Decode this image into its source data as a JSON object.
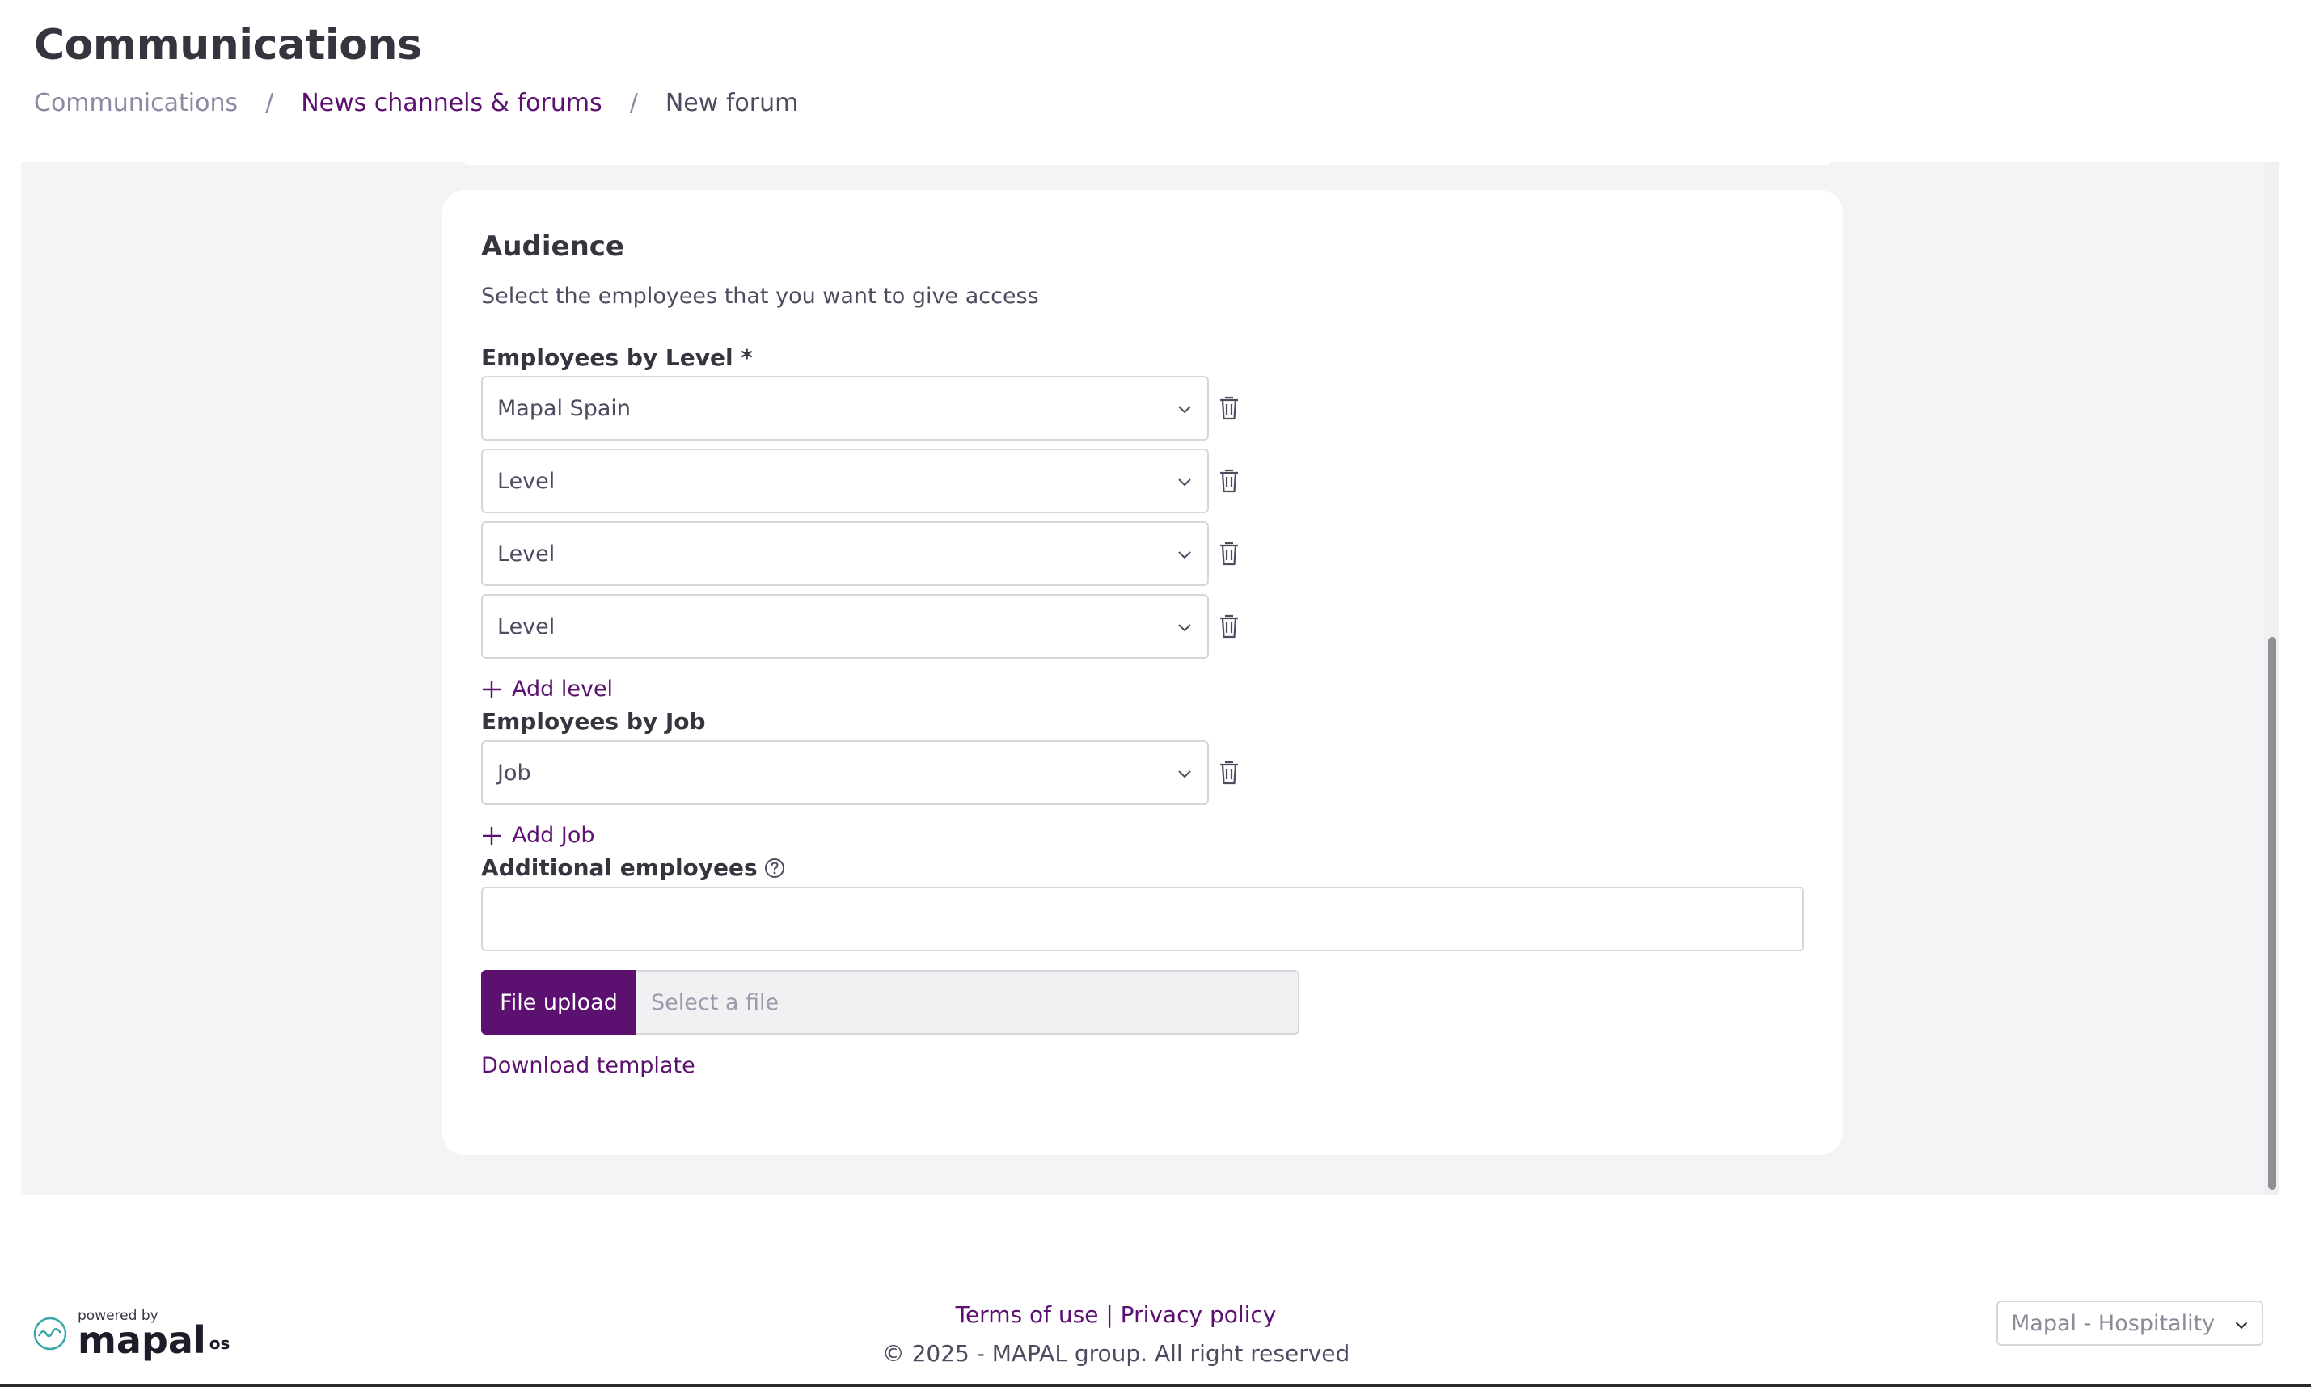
{
  "header": {
    "title": "Communications",
    "breadcrumb": {
      "root": "Communications",
      "parent": "News channels & forums",
      "current": "New forum",
      "separator": "/"
    }
  },
  "audience": {
    "title": "Audience",
    "description": "Select the employees that you want to give access",
    "levels": {
      "label": "Employees by Level *",
      "selects": [
        {
          "value": "Mapal Spain"
        },
        {
          "value": "Level"
        },
        {
          "value": "Level"
        },
        {
          "value": "Level"
        }
      ],
      "add_label": "Add level"
    },
    "jobs": {
      "label": "Employees by Job",
      "selects": [
        {
          "value": "Job"
        }
      ],
      "add_label": "Add Job"
    },
    "additional": {
      "label": "Additional employees",
      "value": ""
    },
    "upload": {
      "button_label": "File upload",
      "placeholder": "Select a file"
    },
    "download_label": "Download template"
  },
  "footer": {
    "powered_by": "powered by",
    "brand": "mapal",
    "brand_suffix": "os",
    "terms": "Terms of use",
    "link_separator": "|",
    "privacy": "Privacy policy",
    "copyright": "© 2025 - MAPAL group. All right reserved",
    "org_select": "Mapal - Hospitality"
  },
  "colors": {
    "accent": "#5c1070",
    "page_bg": "#f4f4f6",
    "text": "#35353f"
  }
}
